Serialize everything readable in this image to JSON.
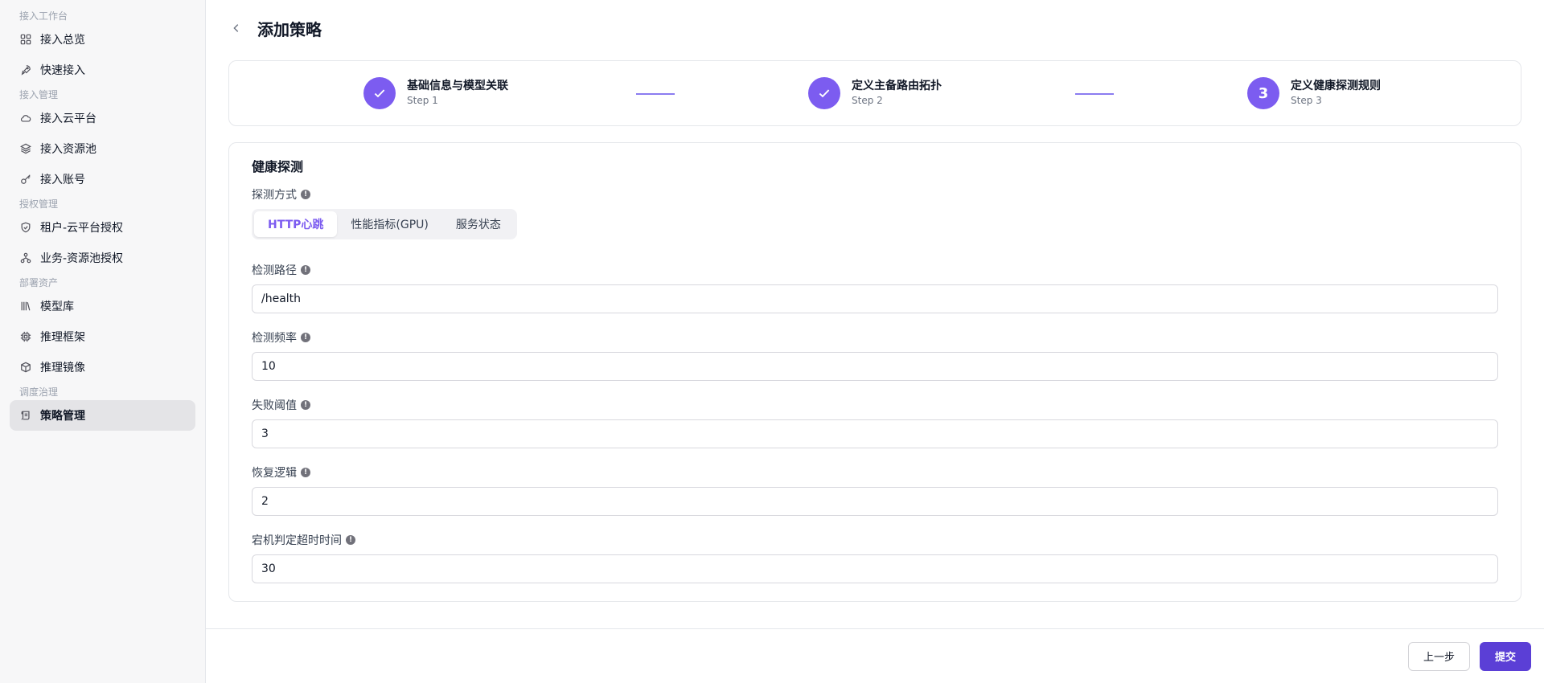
{
  "sidebar": {
    "groups": [
      {
        "label": "接入工作台",
        "items": [
          {
            "label": "接入总览",
            "icon": "grid-icon"
          },
          {
            "label": "快速接入",
            "icon": "rocket-icon"
          }
        ]
      },
      {
        "label": "接入管理",
        "items": [
          {
            "label": "接入云平台",
            "icon": "cloud-icon"
          },
          {
            "label": "接入资源池",
            "icon": "layers-icon"
          },
          {
            "label": "接入账号",
            "icon": "key-icon"
          }
        ]
      },
      {
        "label": "授权管理",
        "items": [
          {
            "label": "租户-云平台授权",
            "icon": "shield-icon"
          },
          {
            "label": "业务-资源池授权",
            "icon": "network-icon"
          }
        ]
      },
      {
        "label": "部署资产",
        "items": [
          {
            "label": "模型库",
            "icon": "library-icon"
          },
          {
            "label": "推理框架",
            "icon": "cpu-icon"
          },
          {
            "label": "推理镜像",
            "icon": "box-icon"
          }
        ]
      },
      {
        "label": "调度治理",
        "items": [
          {
            "label": "策略管理",
            "icon": "scroll-icon",
            "active": true
          }
        ]
      }
    ]
  },
  "header": {
    "title": "添加策略"
  },
  "steps": [
    {
      "title": "基础信息与模型关联",
      "sub": "Step 1",
      "status": "done"
    },
    {
      "title": "定义主备路由拓扑",
      "sub": "Step 2",
      "status": "done"
    },
    {
      "title": "定义健康探测规则",
      "sub": "Step 3",
      "status": "current",
      "number": "3"
    }
  ],
  "form": {
    "section_title": "健康探测",
    "probe_method": {
      "label": "探测方式",
      "options": [
        "HTTP心跳",
        "性能指标(GPU)",
        "服务状态"
      ],
      "selected": "HTTP心跳"
    },
    "fields": [
      {
        "name": "check-path",
        "label": "检测路径",
        "value": "/health"
      },
      {
        "name": "check-frequency",
        "label": "检测频率",
        "value": "10"
      },
      {
        "name": "failure-threshold",
        "label": "失败阈值",
        "value": "3"
      },
      {
        "name": "recovery-logic",
        "label": "恢复逻辑",
        "value": "2"
      },
      {
        "name": "downtime-timeout",
        "label": "宕机判定超时时间",
        "value": "30"
      }
    ]
  },
  "footer": {
    "prev_label": "上一步",
    "submit_label": "提交"
  },
  "colors": {
    "accent": "#7c5cf0",
    "primary_button": "#5b3fd6"
  }
}
